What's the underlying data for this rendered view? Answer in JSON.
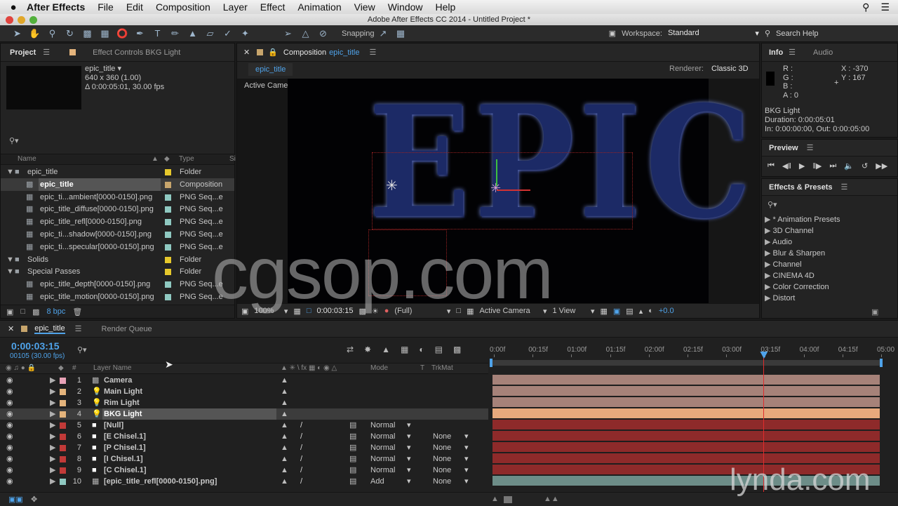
{
  "menubar": {
    "apple": "",
    "app_name": "After Effects",
    "items": [
      "File",
      "Edit",
      "Composition",
      "Layer",
      "Effect",
      "Animation",
      "View",
      "Window",
      "Help"
    ]
  },
  "window_title": "Adobe After Effects CC 2014 - Untitled Project *",
  "toolbar": {
    "snapping_label": "Snapping",
    "workspace_label": "Workspace:",
    "workspace_value": "Standard",
    "search_help": "Search Help"
  },
  "project_panel": {
    "tab_project": "Project",
    "tab_effect_controls": "Effect Controls BKG Light",
    "item_name": "epic_title ▾",
    "item_size": "640 x 360 (1.00)",
    "item_duration": "Δ 0:00:05:01, 30.00 fps",
    "col_name": "Name",
    "col_type": "Type",
    "col_size": "Si",
    "bpc": "8 bpc",
    "rows": [
      {
        "name": "epic_title",
        "type": "Folder",
        "indent": 0,
        "kind": "folder",
        "color": "#e6c82c"
      },
      {
        "name": "epic_title",
        "type": "Composition",
        "indent": 1,
        "kind": "comp",
        "color": "#c7a56c"
      },
      {
        "name": "epic_ti...ambient[0000-0150].png",
        "type": "PNG Seq...e",
        "indent": 1,
        "kind": "seq",
        "color": "#8fc9c1"
      },
      {
        "name": "epic_title_diffuse[0000-0150].png",
        "type": "PNG Seq...e",
        "indent": 1,
        "kind": "seq",
        "color": "#8fc9c1"
      },
      {
        "name": "epic_title_refl[0000-0150].png",
        "type": "PNG Seq...e",
        "indent": 1,
        "kind": "seq",
        "color": "#8fc9c1"
      },
      {
        "name": "epic_ti...shadow[0000-0150].png",
        "type": "PNG Seq...e",
        "indent": 1,
        "kind": "seq",
        "color": "#8fc9c1"
      },
      {
        "name": "epic_ti...specular[0000-0150].png",
        "type": "PNG Seq...e",
        "indent": 1,
        "kind": "seq",
        "color": "#8fc9c1"
      },
      {
        "name": "Solids",
        "type": "Folder",
        "indent": 0,
        "kind": "folder",
        "color": "#e6c82c"
      },
      {
        "name": "Special Passes",
        "type": "Folder",
        "indent": 0,
        "kind": "folder",
        "color": "#e6c82c"
      },
      {
        "name": "epic_title_depth[0000-0150].png",
        "type": "PNG Seq...e",
        "indent": 1,
        "kind": "seq",
        "color": "#8fc9c1"
      },
      {
        "name": "epic_title_motion[0000-0150].png",
        "type": "PNG Seq...e",
        "indent": 1,
        "kind": "seq",
        "color": "#8fc9c1"
      }
    ]
  },
  "comp_panel": {
    "tab_label": "Composition",
    "tab_comp": "epic_title",
    "breadcrumb": "epic_title",
    "renderer_label": "Renderer:",
    "renderer_value": "Classic 3D",
    "active_camera": "Active Camera",
    "viewer_text": "EPIC",
    "zoom": "100%",
    "timecode": "0:00:03:15",
    "resolution": "(Full)",
    "view_camera": "Active Camera",
    "view_count": "1 View",
    "exposure": "+0.0"
  },
  "info_panel": {
    "tab_info": "Info",
    "tab_audio": "Audio",
    "r": "R :",
    "g": "G :",
    "b": "B :",
    "a": "A : 0",
    "x": "X : -370",
    "y": "Y : 167",
    "layer_name": "BKG Light",
    "duration": "Duration: 0:00:05:01",
    "in_out": "In: 0:00:00:00, Out: 0:00:05:00"
  },
  "preview_panel": {
    "title": "Preview"
  },
  "effects_panel": {
    "title": "Effects & Presets",
    "items": [
      "* Animation Presets",
      "3D Channel",
      "Audio",
      "Blur & Sharpen",
      "Channel",
      "CINEMA 4D",
      "Color Correction",
      "Distort"
    ]
  },
  "timeline": {
    "tab_comp": "epic_title",
    "tab_render": "Render Queue",
    "timecode": "0:00:03:15",
    "frame_info": "00105 (30.00 fps)",
    "col_num": "#",
    "col_layer": "Layer Name",
    "col_mode": "Mode",
    "col_t": "T",
    "col_trkmat": "TrkMat",
    "ruler": [
      "0:00f",
      "00:15f",
      "01:00f",
      "01:15f",
      "02:00f",
      "02:15f",
      "03:00f",
      "03:15f",
      "04:00f",
      "04:15f",
      "05:00"
    ],
    "playhead_fraction": 0.7,
    "layers": [
      {
        "num": "1",
        "name": "Camera",
        "label": "#e8a2b6",
        "type": "camera",
        "mode": "",
        "trkmat": "",
        "bar": "#a68279"
      },
      {
        "num": "2",
        "name": "Main Light",
        "label": "#e4b47c",
        "type": "light",
        "mode": "",
        "trkmat": "",
        "bar": "#a68279"
      },
      {
        "num": "3",
        "name": "Rim Light",
        "label": "#e4b47c",
        "type": "light",
        "mode": "",
        "trkmat": "",
        "bar": "#a68279"
      },
      {
        "num": "4",
        "name": "BKG Light",
        "label": "#e4b47c",
        "type": "light",
        "mode": "",
        "trkmat": "",
        "bar": "#e8a97c",
        "selected": true
      },
      {
        "num": "5",
        "name": "[Null]",
        "label": "#c13a38",
        "type": "solid",
        "mode": "Normal",
        "trkmat": "",
        "bar": "#8e2a2a"
      },
      {
        "num": "6",
        "name": "[E Chisel.1]",
        "label": "#c13a38",
        "type": "solid",
        "mode": "Normal",
        "trkmat": "None",
        "bar": "#8e2a2a"
      },
      {
        "num": "7",
        "name": "[P Chisel.1]",
        "label": "#c13a38",
        "type": "solid",
        "mode": "Normal",
        "trkmat": "None",
        "bar": "#8e2a2a"
      },
      {
        "num": "8",
        "name": "[I Chisel.1]",
        "label": "#c13a38",
        "type": "solid",
        "mode": "Normal",
        "trkmat": "None",
        "bar": "#8e2a2a"
      },
      {
        "num": "9",
        "name": "[C Chisel.1]",
        "label": "#c13a38",
        "type": "solid",
        "mode": "Normal",
        "trkmat": "None",
        "bar": "#8e2a2a"
      },
      {
        "num": "10",
        "name": "[epic_title_refl[0000-0150].png]",
        "label": "#8fc9c1",
        "type": "seq",
        "mode": "Add",
        "trkmat": "None",
        "bar": "#6d8d88"
      }
    ]
  },
  "watermarks": {
    "cgsop": "cgsop.com",
    "lynda": "lynda.com"
  },
  "colors": {
    "accent_blue": "#4fa3ea",
    "playhead": "#e02c2c",
    "selected_bar": "#e8a97c"
  }
}
